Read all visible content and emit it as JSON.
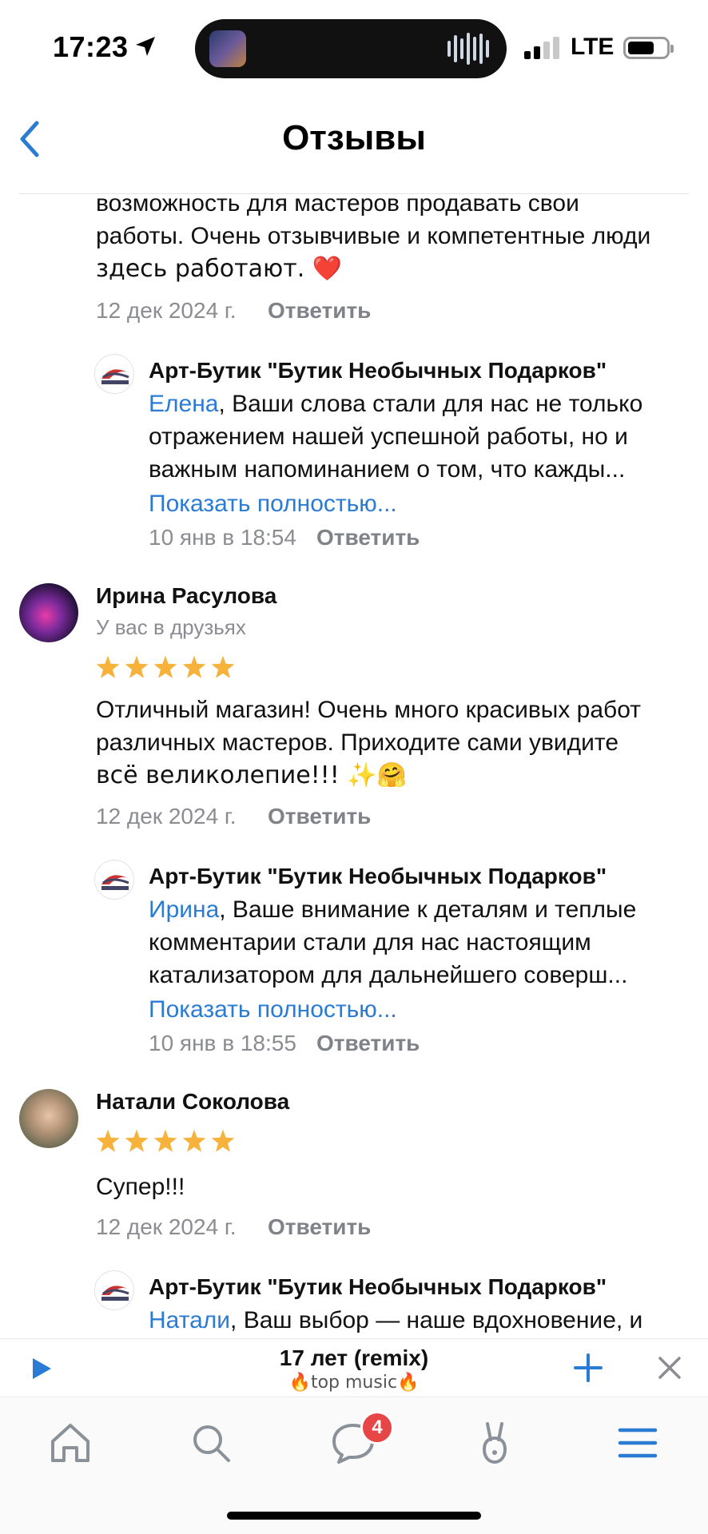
{
  "status": {
    "time": "17:23",
    "network": "LTE"
  },
  "header": {
    "title": "Отзывы"
  },
  "reviews": [
    {
      "text_lines": [
        "возможность для мастеров продавать свои",
        "работы. Очень отзывчивые и компетентные люди",
        "здесь работают. ❤️"
      ],
      "date": "12 дек 2024 г.",
      "reply_label": "Ответить",
      "shop_reply": {
        "author": "Арт-Бутик \"Бутик Необычных Подарков\"",
        "mention": "Елена",
        "line1_rest": ", Ваши слова стали для нас не только",
        "line2": "отражением нашей успешной работы, но и",
        "line3": "важным напоминанием о том, что кажды...",
        "show_more": "Показать полностью...",
        "date": "10 янв в 18:54",
        "reply_label": "Ответить"
      }
    },
    {
      "author": "Ирина Расулова",
      "subtitle": "У вас в друзьях",
      "rating": 5,
      "text_lines": [
        "Отличный магазин! Очень много красивых работ",
        "различных мастеров. Приходите сами увидите",
        "всё великолепие!!! ✨🤗"
      ],
      "date": "12 дек 2024 г.",
      "reply_label": "Ответить",
      "shop_reply": {
        "author": "Арт-Бутик \"Бутик Необычных Подарков\"",
        "mention": "Ирина",
        "line1_rest": ", Ваше внимание к деталям и теплые",
        "line2": "комментарии стали для нас настоящим",
        "line3": "катализатором для дальнейшего соверш...",
        "show_more": "Показать полностью...",
        "date": "10 янв в 18:55",
        "reply_label": "Ответить"
      }
    },
    {
      "author": "Натали Соколова",
      "rating": 5,
      "text_lines": [
        "Супер!!!"
      ],
      "date": "12 дек 2024 г.",
      "reply_label": "Ответить",
      "shop_reply": {
        "author": "Арт-Бутик \"Бутик Необычных Подарков\"",
        "mention": "Натали",
        "line1_rest": ", Ваш выбор — наше вдохновение, и"
      }
    }
  ],
  "player": {
    "track": "17 лет (remix)",
    "artist": "🔥top music🔥"
  },
  "tabbar": {
    "items": [
      "home-icon",
      "search-icon",
      "messages-icon",
      "clips-icon",
      "menu-icon"
    ],
    "messages_badge": "4"
  },
  "colors": {
    "accent": "#2a7bd4",
    "star": "#f6b23a",
    "badge": "#e64646",
    "muted": "#8a8c91"
  }
}
